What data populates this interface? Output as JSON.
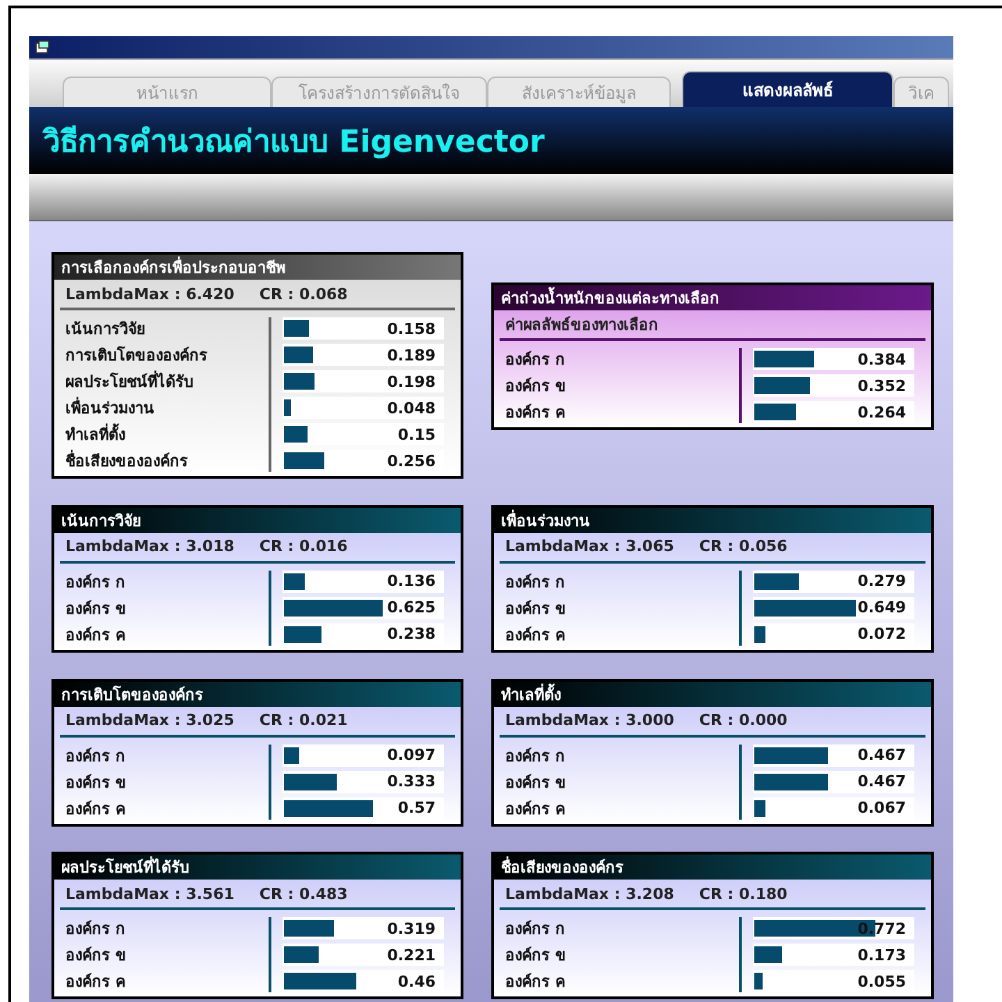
{
  "tabs": [
    {
      "label": "หน้าแรก",
      "selected": false
    },
    {
      "label": "โครงสร้างการตัดสินใจ",
      "selected": false
    },
    {
      "label": "สังเคราะห์ข้อมูล",
      "selected": false
    },
    {
      "label": "แสดงผลลัพธ์",
      "selected": true
    },
    {
      "label": "วิเค",
      "selected": false
    }
  ],
  "heading": "วิธีการคำนวณค่าแบบ Eigenvector",
  "panels": [
    {
      "kind": "overall",
      "title": "การเลือกองค์กรเพื่อประกอบอาชีพ",
      "lambda": "LambdaMax : 6.420",
      "cr": "CR : 0.068",
      "rows": [
        {
          "label": "เน้นการวิจัย",
          "value": "0.158",
          "level": 0.158
        },
        {
          "label": "การเติบโตขององค์กร",
          "value": "0.189",
          "level": 0.189
        },
        {
          "label": "ผลประโยชน์ที่ได้รับ",
          "value": "0.198",
          "level": 0.198
        },
        {
          "label": "เพื่อนร่วมงาน",
          "value": "0.048",
          "level": 0.048
        },
        {
          "label": "ทำเลที่ตั้ง",
          "value": "0.15",
          "level": 0.15
        },
        {
          "label": "ชื่อเสียงขององค์กร",
          "value": "0.256",
          "level": 0.256
        }
      ]
    },
    {
      "kind": "result",
      "title": "ค่าถ่วงน้ำหนักของแต่ละทางเลือก",
      "subtitle": "ค่าผลลัพธ์ของทางเลือก",
      "rows": [
        {
          "label": "องค์กร ก",
          "value": "0.384",
          "level": 0.384
        },
        {
          "label": "องค์กร ข",
          "value": "0.352",
          "level": 0.352
        },
        {
          "label": "องค์กร ค",
          "value": "0.264",
          "level": 0.264
        }
      ]
    },
    {
      "kind": "criterion",
      "title": "เน้นการวิจัย",
      "lambda": "LambdaMax : 3.018",
      "cr": "CR : 0.016",
      "rows": [
        {
          "label": "องค์กร ก",
          "value": "0.136",
          "level": 0.136
        },
        {
          "label": "องค์กร ข",
          "value": "0.625",
          "level": 0.625
        },
        {
          "label": "องค์กร ค",
          "value": "0.238",
          "level": 0.238
        }
      ]
    },
    {
      "kind": "criterion",
      "title": "เพื่อนร่วมงาน",
      "lambda": "LambdaMax : 3.065",
      "cr": "CR : 0.056",
      "rows": [
        {
          "label": "องค์กร ก",
          "value": "0.279",
          "level": 0.279
        },
        {
          "label": "องค์กร ข",
          "value": "0.649",
          "level": 0.649
        },
        {
          "label": "องค์กร ค",
          "value": "0.072",
          "level": 0.072
        }
      ]
    },
    {
      "kind": "criterion",
      "title": "การเติบโตขององค์กร",
      "lambda": "LambdaMax : 3.025",
      "cr": "CR : 0.021",
      "rows": [
        {
          "label": "องค์กร ก",
          "value": "0.097",
          "level": 0.097
        },
        {
          "label": "องค์กร ข",
          "value": "0.333",
          "level": 0.333
        },
        {
          "label": "องค์กร ค",
          "value": "0.57",
          "level": 0.57
        }
      ]
    },
    {
      "kind": "criterion",
      "title": "ทำเลที่ตั้ง",
      "lambda": "LambdaMax : 3.000",
      "cr": "CR : 0.000",
      "rows": [
        {
          "label": "องค์กร ก",
          "value": "0.467",
          "level": 0.467
        },
        {
          "label": "องค์กร ข",
          "value": "0.467",
          "level": 0.467
        },
        {
          "label": "องค์กร ค",
          "value": "0.067",
          "level": 0.067
        }
      ]
    },
    {
      "kind": "criterion",
      "title": "ผลประโยชน์ที่ได้รับ",
      "lambda": "LambdaMax : 3.561",
      "cr": "CR : 0.483",
      "rows": [
        {
          "label": "องค์กร ก",
          "value": "0.319",
          "level": 0.319
        },
        {
          "label": "องค์กร ข",
          "value": "0.221",
          "level": 0.221
        },
        {
          "label": "องค์กร ค",
          "value": "0.46",
          "level": 0.46
        }
      ]
    },
    {
      "kind": "criterion",
      "title": "ชื่อเสียงขององค์กร",
      "lambda": "LambdaMax : 3.208",
      "cr": "CR : 0.180",
      "rows": [
        {
          "label": "องค์กร ก",
          "value": "0.772",
          "level": 0.772
        },
        {
          "label": "องค์กร ข",
          "value": "0.173",
          "level": 0.173
        },
        {
          "label": "องค์กร ค",
          "value": "0.055",
          "level": 0.055
        }
      ]
    }
  ]
}
